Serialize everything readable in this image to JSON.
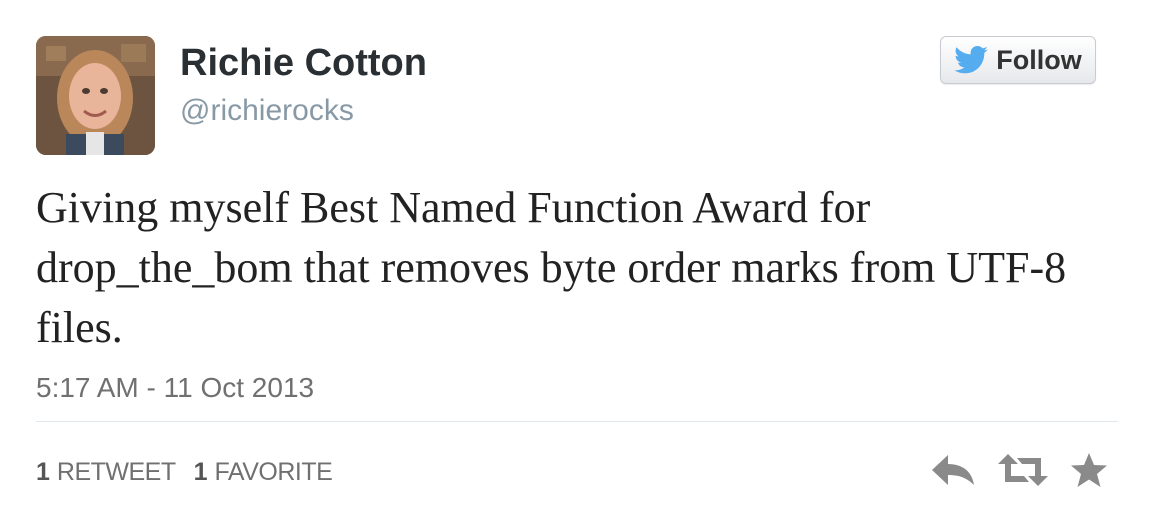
{
  "user": {
    "name": "Richie Cotton",
    "handle": "@richierocks"
  },
  "follow_button": {
    "label": "Follow"
  },
  "tweet": {
    "text": "Giving myself Best Named Function Award for drop_the_bom that removes byte order marks from UTF-8 files.",
    "timestamp": "5:17 AM - 11 Oct 2013"
  },
  "stats": {
    "retweets": {
      "count": "1",
      "label": "RETWEET"
    },
    "favorites": {
      "count": "1",
      "label": "FAVORITE"
    }
  },
  "actions": {
    "reply_icon": "reply-icon",
    "retweet_icon": "retweet-icon",
    "favorite_icon": "star-icon"
  },
  "colors": {
    "twitter_blue": "#55acee",
    "text_gray": "#707070",
    "icon_gray": "#8a8a8a"
  }
}
